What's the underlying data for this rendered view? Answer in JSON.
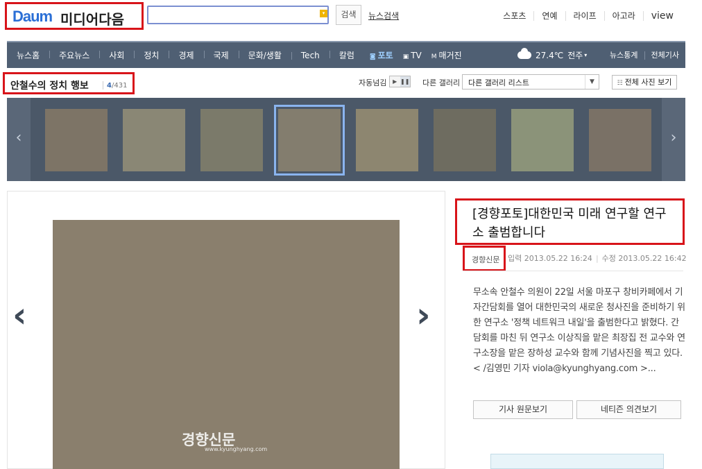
{
  "logo": {
    "mark": "Daum",
    "text": "미디어다음"
  },
  "search": {
    "placeholder": "",
    "button": "검색",
    "news_search": "뉴스검색"
  },
  "top_links": [
    "스포츠",
    "연예",
    "라이프",
    "아고라",
    "view"
  ],
  "nav": {
    "items": [
      "뉴스홈",
      "주요뉴스",
      "사회",
      "정치",
      "경제",
      "국제",
      "문화/생활",
      "Tech",
      "칼럼"
    ],
    "media": [
      {
        "label": "포토",
        "icon": "camera-icon",
        "active": true
      },
      {
        "label": "TV",
        "icon": "tv-icon",
        "active": false
      },
      {
        "label": "매거진",
        "icon": "magazine-icon",
        "active": false
      }
    ],
    "weather": {
      "temp": "27.4℃",
      "city": "전주",
      "icon": "cloud-icon"
    },
    "right": [
      "뉴스통계",
      "전체기사"
    ]
  },
  "gallery": {
    "title": "안철수의 정치 행보",
    "current": "4",
    "total": "/431",
    "auto_label": "자동넘김",
    "other_label": "다른 갤러리",
    "select_value": "다른 갤러리 리스트",
    "all_photos": "전체 사진 보기",
    "thumbnails": 8,
    "selected_index": 3
  },
  "photo": {
    "watermark": "경향신문",
    "watermark_url": "www.kyunghyang.com"
  },
  "article": {
    "headline": "[경향포토]대한민국 미래 연구할 연구소 출범합니다",
    "source": "경향신문",
    "input_label": "입력",
    "input_date": "2013.05.22 16:24",
    "edit_label": "수정",
    "edit_date": "2013.05.22 16:42",
    "body": "무소속 안철수 의원이 22일 서울 마포구 창비카페에서 기자간담회를 열어 대한민국의 새로운 청사진을 준비하기 위한 연구소 '정책 네트워크 내일'을 출범한다고 밝혔다. 간담회를 마친 뒤 연구소 이상직을 맡은 최장집 전 교수와 연구소장을 맡은 장하성 교수와 함께 기념사진을 찍고 있다.< /김영민 기자 viola@kyunghyang.com >...",
    "btn_original": "기사 원문보기",
    "btn_comments": "네티즌 의견보기"
  },
  "colors": {
    "nav_bg": "#4f5f73",
    "highlight": "#d8141a",
    "active": "#9fd0ff"
  }
}
